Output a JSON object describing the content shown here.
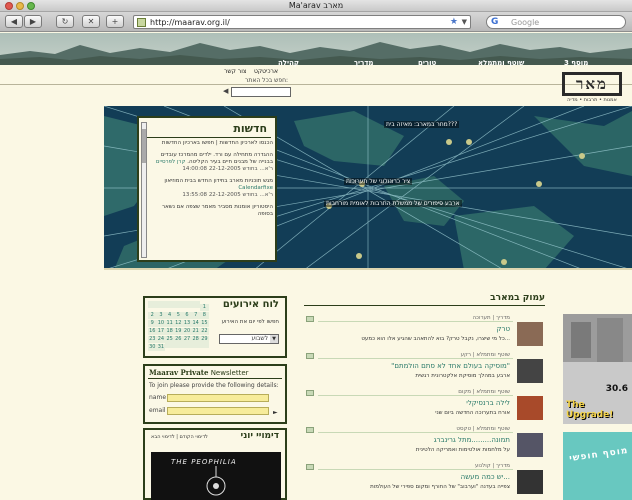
{
  "window": {
    "title": "Ma'arav מארב"
  },
  "toolbar": {
    "back": "◀",
    "forward": "▶",
    "reload": "↻",
    "stop": "✕",
    "add": "+",
    "url": "http://maarav.org.il/",
    "search_placeholder": "Google"
  },
  "nav": {
    "items": [
      "מוסף 3",
      "שוטף ומתמלא",
      "טורים",
      "מדריך",
      "קהילה"
    ]
  },
  "utility": {
    "links": [
      "צור קשר",
      "ארכיטקט"
    ],
    "search_label": "חפש בכל האתר:"
  },
  "logo": {
    "mark": "מאר",
    "subtitle": "אמנות • תרבות • מדיה"
  },
  "hero": {
    "tag1": "מחר במארב: מאיזה בית???",
    "tag2": "ציר כרונולוגי של תערוכות",
    "tag3": "ארבע סיפורים של ממשלת התרבות לאומית מורחבות"
  },
  "news": {
    "title": "חדשות",
    "items": [
      {
        "text": "הכנסו לארכיון החדשות | חפשו בארכיון החדשות",
        "link": "",
        "date": ""
      },
      {
        "text": "ההגדרה מתחילה עם ורד. ילדים מהמרכז עובדים בבנייה של מבנים חיים בעיר הקליטה.",
        "link": "קרן לפרסיים",
        "date": "ר'א... בחודש 22-12-2005 14:00:08"
      },
      {
        "text": "מגש תוכניות מארב בחידון החדש בבית המוזיאון",
        "link": "Calendarfixe",
        "date": "ר'א... בחודש 22-12-2005 13:55:08"
      },
      {
        "text": "היסטוריון אומנות מסביר מאמר שצפה אם נשאר בסופה",
        "link": "",
        "date": ""
      }
    ]
  },
  "events": {
    "title": "לוח אירועים",
    "subtitle": "חפשו לפי יום את האירוע",
    "select_value": "לשבוע",
    "calendar": [
      [
        "",
        "",
        "",
        "",
        "",
        "",
        "1"
      ],
      [
        "2",
        "3",
        "4",
        "5",
        "6",
        "7",
        "8"
      ],
      [
        "9",
        "10",
        "11",
        "12",
        "13",
        "14",
        "15"
      ],
      [
        "16",
        "17",
        "18",
        "19",
        "20",
        "21",
        "22"
      ],
      [
        "23",
        "24",
        "25",
        "26",
        "27",
        "28",
        "29"
      ],
      [
        "30",
        "31",
        "",
        "",
        "",
        "",
        ""
      ]
    ]
  },
  "newsletter": {
    "brand": "Maarav Private",
    "title_suffix": "Newsletter",
    "desc": "To join please provide the following details:",
    "name_label": "name",
    "email_label": "email",
    "go": "►"
  },
  "yoni": {
    "title": "דימויי יוני",
    "links": "לדימוי הקודם | לדימוי הבא",
    "caption": "THE PEOPHILIA"
  },
  "feed": {
    "title": "עמוק במארב",
    "items": [
      {
        "meta": "מדריך | תערוכה",
        "head": "טרק",
        "body": "כל מי שיצרו, נקבל טרק? בוא להתאהב שהגיע אלו הוא כמעט..."
      },
      {
        "meta": "שוטף ומתמלא | רקע",
        "head": "\"מוסיקה בעולם אחד לא סתם הולמתם\"",
        "body": "ארבע במהלך מוסיקת אלקטרונית רגשית"
      },
      {
        "meta": "שוטף ומתמלא | מקום",
        "head": "לילה ברנסיקלי",
        "body": "אורח בתערוכה החדשה ביום שני"
      },
      {
        "meta": "שוטף ומתמלא | טקסט",
        "head": "תמונה.........מתל גרינברג",
        "body": "על מלחמות אולטימות ואמריקה הלטינית"
      },
      {
        "meta": "מדריך | קולנוע",
        "head": "יש כמה מעשה...",
        "body": "צפייה בעדנה \"וערבוב\" של החורף ומקום ספירי של העולמות"
      }
    ]
  },
  "promos": {
    "upgrade_num": "30.6",
    "upgrade_text": "The Upgrade!",
    "promo2_text": "מוסף חופשי"
  }
}
